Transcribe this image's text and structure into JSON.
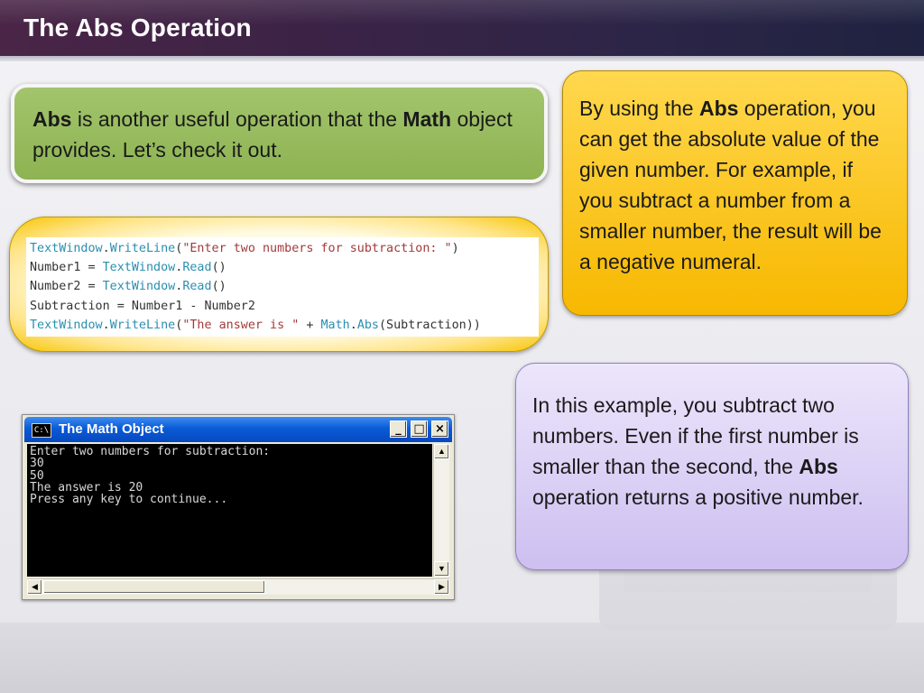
{
  "slide": {
    "title": "The Abs Operation"
  },
  "intro_box": {
    "part1_bold": "Abs",
    "part2": " is another useful operation that the ",
    "part3_bold": "Math",
    "part4": " object provides. Let’s check it out."
  },
  "code": {
    "lines": [
      [
        {
          "t": "TextWindow",
          "c": "kw"
        },
        {
          "t": ".",
          "c": "pl"
        },
        {
          "t": "WriteLine",
          "c": "kw"
        },
        {
          "t": "(",
          "c": "pl"
        },
        {
          "t": "\"Enter two numbers for subtraction: \"",
          "c": "str"
        },
        {
          "t": ")",
          "c": "pl"
        }
      ],
      [
        {
          "t": "Number1 = ",
          "c": "pl"
        },
        {
          "t": "TextWindow",
          "c": "kw"
        },
        {
          "t": ".",
          "c": "pl"
        },
        {
          "t": "Read",
          "c": "kw"
        },
        {
          "t": "()",
          "c": "pl"
        }
      ],
      [
        {
          "t": "Number2 = ",
          "c": "pl"
        },
        {
          "t": "TextWindow",
          "c": "kw"
        },
        {
          "t": ".",
          "c": "pl"
        },
        {
          "t": "Read",
          "c": "kw"
        },
        {
          "t": "()",
          "c": "pl"
        }
      ],
      [
        {
          "t": "Subtraction = Number1 - Number2",
          "c": "pl"
        }
      ],
      [
        {
          "t": "TextWindow",
          "c": "kw"
        },
        {
          "t": ".",
          "c": "pl"
        },
        {
          "t": "WriteLine",
          "c": "kw"
        },
        {
          "t": "(",
          "c": "pl"
        },
        {
          "t": "\"The answer is \"",
          "c": "str"
        },
        {
          "t": " + ",
          "c": "pl"
        },
        {
          "t": "Math",
          "c": "kw"
        },
        {
          "t": ".",
          "c": "pl"
        },
        {
          "t": "Abs",
          "c": "kw"
        },
        {
          "t": "(Subtraction))",
          "c": "pl"
        }
      ]
    ]
  },
  "explain_box": {
    "part1": "By using the ",
    "part2_bold": "Abs",
    "part3": " operation, you can get the absolute value of the given number. For example, if you subtract a number from a smaller number, the result will be a negative numeral."
  },
  "example_box": {
    "part1": "In this example, you subtract two numbers. Even if the first number is smaller than the second, the ",
    "part2_bold": "Abs",
    "part3": " operation returns a positive number."
  },
  "console": {
    "icon_text": "C:\\",
    "title": "The Math Object",
    "minimize": "_",
    "maximize": "□",
    "close": "×",
    "lines": [
      "Enter two numbers for subtraction:",
      "30",
      "50",
      "The answer is 20",
      "Press any key to continue..."
    ],
    "scroll_up": "▲",
    "scroll_down": "▼",
    "scroll_left": "◀",
    "scroll_right": "▶"
  },
  "colors": {
    "title_bar": "#3b2346",
    "intro_box": "#97bb5d",
    "code_box": "#ffe488",
    "explain_box": "#ffc61a",
    "example_box": "#ddd3f6",
    "console_titlebar": "#0a5bd6"
  }
}
